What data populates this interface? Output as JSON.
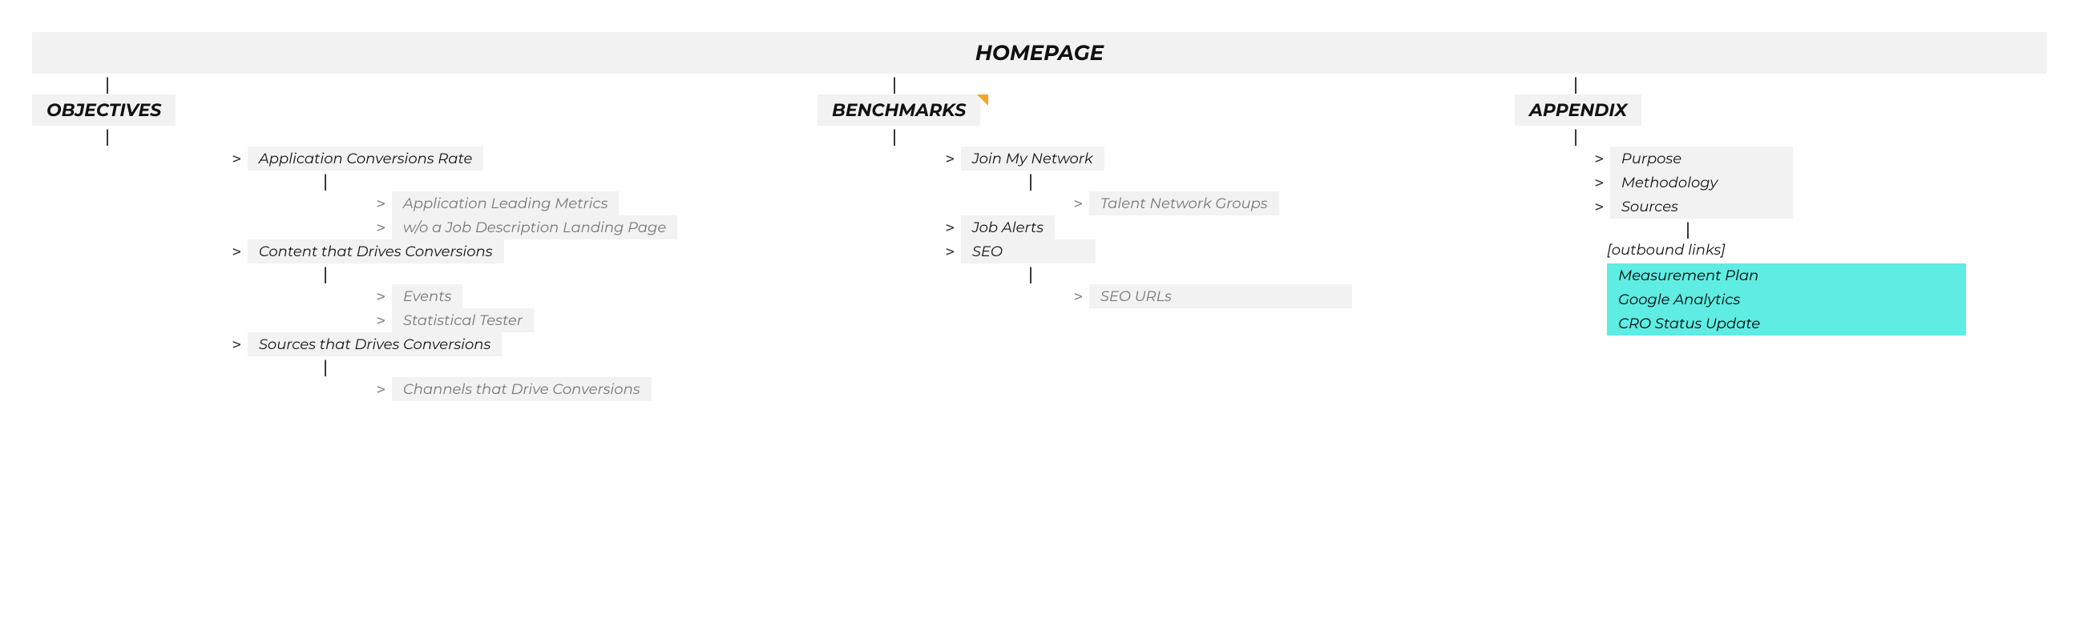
{
  "root": {
    "title": "HOMEPAGE"
  },
  "columns": {
    "objectives": {
      "title": "OBJECTIVES",
      "items": {
        "i0": {
          "label": "Application Conversions Rate",
          "children": {
            "c0": "Application Leading Metrics",
            "c1": "w/o a Job Description Landing Page"
          }
        },
        "i1": {
          "label": "Content that Drives Conversions",
          "children": {
            "c0": "Events",
            "c1": "Statistical Tester"
          }
        },
        "i2": {
          "label": "Sources that Drives Conversions",
          "children": {
            "c0": "Channels that Drive Conversions"
          }
        }
      }
    },
    "benchmarks": {
      "title": "BENCHMARKS",
      "items": {
        "i0": {
          "label": "Join My Network",
          "children": {
            "c0": "Talent Network Groups"
          }
        },
        "i1": {
          "label": "Job Alerts"
        },
        "i2": {
          "label": "SEO",
          "children": {
            "c0": "SEO URLs"
          }
        }
      }
    },
    "appendix": {
      "title": "APPENDIX",
      "items": {
        "i0": {
          "label": "Purpose"
        },
        "i1": {
          "label": "Methodology"
        },
        "i2": {
          "label": "Sources",
          "outbound_label": "[outbound links]",
          "outbound": {
            "l0": "Measurement Plan",
            "l1": "Google Analytics",
            "l2": "CRO Status Update"
          }
        }
      }
    }
  },
  "glyph": {
    "chev": ">",
    "pipe": "|"
  }
}
